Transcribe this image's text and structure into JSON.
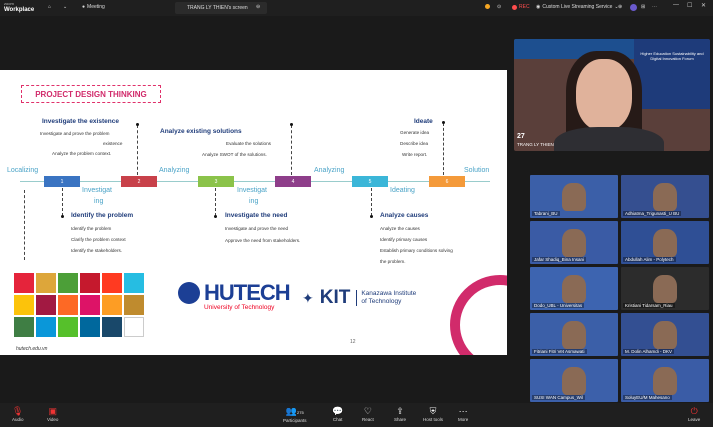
{
  "topbar": {
    "brand_line1": "zoom",
    "brand_line2": "Workplace",
    "meeting_label": "Meeting",
    "share_label": "TRANG LY THIEN's screen",
    "rec_label": "REC",
    "streaming_label": "Custom Live Streaming Service"
  },
  "slide": {
    "title": "PROJECT DESIGN THINKING",
    "stages": {
      "localizing": "Localizing",
      "investigating_line1": "Investigat",
      "investigating_line2": "ing",
      "analyzing1": "Analyzing",
      "investigating2_line1": "Investigat",
      "investigating2_line2": "ing",
      "analyzing2": "Analyzing",
      "ideating": "Ideating",
      "solution": "Solution"
    },
    "boxes": [
      "1",
      "2",
      "3",
      "4",
      "5",
      "6"
    ],
    "blocks": {
      "investigate_existence": {
        "heading": "Investigate the existence",
        "lines": [
          "Investigate and prove the problem",
          "existence",
          "Analyze the problem context."
        ]
      },
      "analyze_existing": {
        "heading": "Analyze existing solutions",
        "lines": [
          "Evaluate the solutions",
          "Analyze SWOT of the solutions."
        ]
      },
      "ideate": {
        "heading": "Ideate",
        "lines": [
          "Generate idea",
          "Describe idea",
          "Write report."
        ]
      },
      "identify_problem": {
        "heading": "Identify the problem",
        "lines": [
          "Identify the problem",
          "Clarify the problem context",
          "Identify the stakeholders."
        ]
      },
      "investigate_need": {
        "heading": "Investigate the need",
        "lines": [
          "Investigate and prove the need",
          "Approve the need from stakeholders."
        ]
      },
      "analyze_causes": {
        "heading": "Analyze causes",
        "lines": [
          "Analyze the causes",
          "Identify primary causes",
          "Establish primary conditions solving",
          "the problem."
        ]
      }
    },
    "hutech_name": "HUTECH",
    "hutech_sub": "University of Technology",
    "kit_name": "KIT",
    "kit_line1": "Kanazawa Institute",
    "kit_line2": "of Technology",
    "website": "hutech.edu.vn",
    "page_number": "12"
  },
  "speaker": {
    "number": "27",
    "name": "TRANG LY THIEN",
    "banner": "Higher Education Sustainability and Digital Innovation Forum"
  },
  "participants": [
    {
      "name": "Tabrani_BU"
    },
    {
      "name": "Adhiatma_Trigunasti_U BU"
    },
    {
      "name": "Jafar Shadiq_Bina Insani"
    },
    {
      "name": "Abdullah Alim - Polytech"
    },
    {
      "name": "Dodo_UBL - Universitas"
    },
    {
      "name": "Kristiani Tidarsam_Riau"
    },
    {
      "name": "Fitriani Fitri Vet Asmawati"
    },
    {
      "name": "M. Dolin Alhamdi - DKV"
    },
    {
      "name": "SUSI WAN Campus_Wil"
    },
    {
      "name": "SoluyEU/M Mahesano"
    }
  ],
  "bottombar": {
    "audio": "Audio",
    "video": "Video",
    "participants": "Participants",
    "participants_count": "275",
    "chat": "Chat",
    "react": "React",
    "share": "Share",
    "host_tools": "Host tools",
    "more": "More",
    "leave": "Leave"
  }
}
